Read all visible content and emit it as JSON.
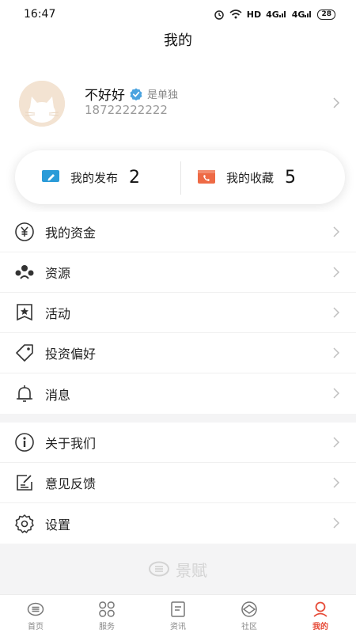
{
  "status_bar": {
    "time": "16:47",
    "network": "HD",
    "signal1": "4G",
    "signal2": "4G",
    "battery": "28"
  },
  "header": {
    "title": "我的"
  },
  "profile": {
    "name": "不好好",
    "tag": "是单独",
    "phone": "18722222222",
    "verified_color": "#4aa3df"
  },
  "stats": {
    "published_label": "我的发布",
    "published_count": "2",
    "favorites_label": "我的收藏",
    "favorites_count": "5",
    "published_icon": "edit-icon",
    "favorites_icon": "phone-book-icon"
  },
  "menu_group_1": [
    {
      "label": "我的资金",
      "icon": "yuan-icon"
    },
    {
      "label": "资源",
      "icon": "people-group-icon"
    },
    {
      "label": "活动",
      "icon": "star-flag-icon"
    },
    {
      "label": "投资偏好",
      "icon": "tag-icon"
    },
    {
      "label": "消息",
      "icon": "bell-icon"
    }
  ],
  "menu_group_2": [
    {
      "label": "关于我们",
      "icon": "info-icon"
    },
    {
      "label": "意见反馈",
      "icon": "feedback-icon"
    },
    {
      "label": "设置",
      "icon": "gear-icon"
    }
  ],
  "watermark": {
    "text": "景赋"
  },
  "tabbar": {
    "tabs": [
      {
        "label": "首页",
        "icon": "home-logo-icon"
      },
      {
        "label": "服务",
        "icon": "grid-icon"
      },
      {
        "label": "资讯",
        "icon": "news-icon"
      },
      {
        "label": "社区",
        "icon": "community-icon"
      },
      {
        "label": "我的",
        "icon": "user-icon",
        "active": true
      }
    ],
    "active_color": "#e64a37"
  }
}
